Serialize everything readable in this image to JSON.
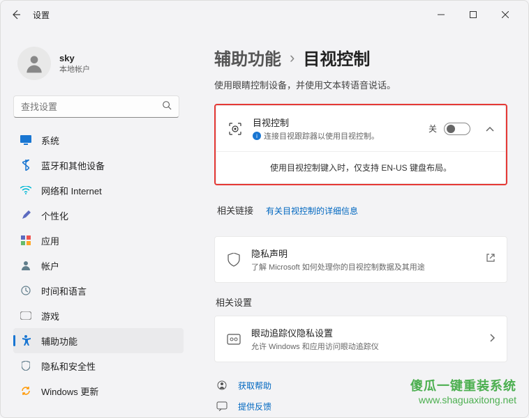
{
  "window": {
    "title": "设置"
  },
  "user": {
    "name": "sky",
    "type": "本地帐户"
  },
  "search": {
    "placeholder": "查找设置"
  },
  "nav": [
    {
      "label": "系统",
      "icon": "system",
      "color": "#1976d2"
    },
    {
      "label": "蓝牙和其他设备",
      "icon": "bluetooth",
      "color": "#1976d2"
    },
    {
      "label": "网络和 Internet",
      "icon": "wifi",
      "color": "#00b8d4"
    },
    {
      "label": "个性化",
      "icon": "brush",
      "color": "#e67e22"
    },
    {
      "label": "应用",
      "icon": "apps",
      "color": "#5c6bc0"
    },
    {
      "label": "帐户",
      "icon": "person",
      "color": "#607d8b"
    },
    {
      "label": "时间和语言",
      "icon": "clock",
      "color": "#607d8b"
    },
    {
      "label": "游戏",
      "icon": "game",
      "color": "#888"
    },
    {
      "label": "辅助功能",
      "icon": "accessibility",
      "color": "#1976d2",
      "active": true
    },
    {
      "label": "隐私和安全性",
      "icon": "shield",
      "color": "#607d8b"
    },
    {
      "label": "Windows 更新",
      "icon": "update",
      "color": "#ff9800"
    }
  ],
  "breadcrumb": {
    "parent": "辅助功能",
    "sep": "›",
    "current": "目视控制"
  },
  "subtitle": "使用眼睛控制设备，并使用文本转语音说话。",
  "eye_control": {
    "title": "目视控制",
    "desc": "连接目视跟踪器以使用目视控制。",
    "toggle_label": "关",
    "note": "使用目视控制键入时，仅支持 EN-US 键盘布局。"
  },
  "related_links": {
    "header": "相关链接",
    "link": "有关目视控制的详细信息"
  },
  "privacy": {
    "title": "隐私声明",
    "desc": "了解 Microsoft 如何处理你的目视控制数据及其用途"
  },
  "related_settings": {
    "header": "相关设置",
    "tracker_title": "眼动追踪仪隐私设置",
    "tracker_desc": "允许 Windows 和应用访问眼动追踪仪"
  },
  "help": {
    "get_help": "获取帮助",
    "feedback": "提供反馈"
  },
  "watermark": {
    "line1": "傻瓜一键重装系统",
    "line2": "www.shaguaxitong.net"
  }
}
